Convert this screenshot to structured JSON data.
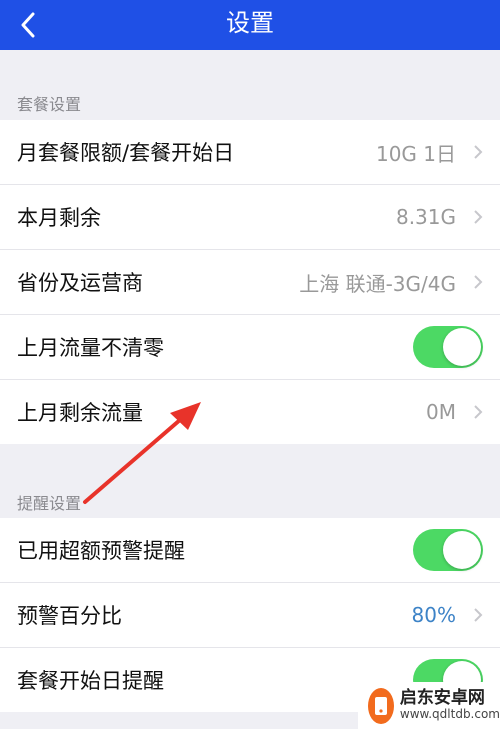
{
  "header": {
    "title": "设置",
    "back_icon": "chevron-left-icon"
  },
  "sections": [
    {
      "label": "套餐设置",
      "rows": [
        {
          "title": "月套餐限额/套餐开始日",
          "value": "10G 1日",
          "type": "value"
        },
        {
          "title": "本月剩余",
          "value": "8.31G",
          "type": "value"
        },
        {
          "title": "省份及运营商",
          "value": "上海 联通-3G/4G",
          "type": "value"
        },
        {
          "title": "上月流量不清零",
          "type": "toggle",
          "on": true
        },
        {
          "title": "上月剩余流量",
          "value": "0M",
          "type": "value"
        }
      ]
    },
    {
      "label": "提醒设置",
      "rows": [
        {
          "title": "已用超额预警提醒",
          "type": "toggle",
          "on": true
        },
        {
          "title": "预警百分比",
          "value": "80%",
          "type": "value",
          "value_color": "#3d83c7"
        },
        {
          "title": "套餐开始日提醒",
          "type": "toggle",
          "on": true
        }
      ]
    }
  ],
  "watermark": {
    "name": "启东安卓网",
    "url": "www.qdltdb.com"
  },
  "colors": {
    "header": "#1f50e6",
    "toggle_on": "#4cd964",
    "arrow": "#e8332a",
    "accent": "#3d83c7"
  }
}
